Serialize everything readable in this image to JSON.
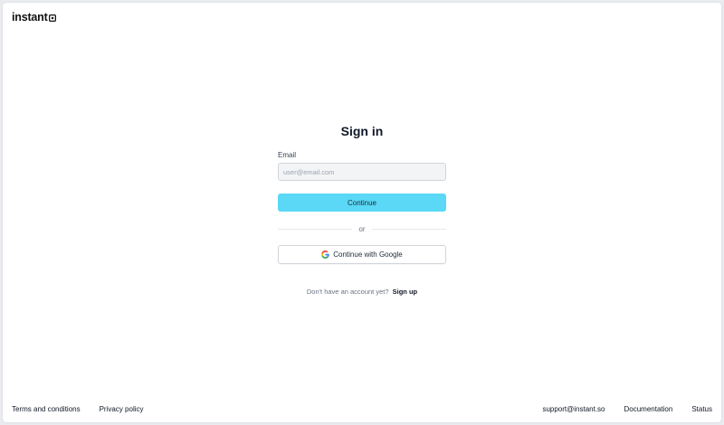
{
  "brand": {
    "name": "instant",
    "logo_icon": "instant-logo-mark-icon"
  },
  "signin": {
    "title": "Sign in",
    "email_label": "Email",
    "email_placeholder": "user@email.com",
    "email_value": "",
    "continue_label": "Continue",
    "divider_text": "or",
    "google_label": "Continue with Google",
    "google_icon": "google-g-icon",
    "no_account_text": "Don't have an account yet?",
    "signup_label": "Sign up"
  },
  "footer": {
    "left": [
      {
        "label": "Terms and conditions"
      },
      {
        "label": "Privacy policy"
      }
    ],
    "right": [
      {
        "label": "support@instant.so"
      },
      {
        "label": "Documentation"
      },
      {
        "label": "Status"
      }
    ]
  },
  "colors": {
    "accent": "#5ad8f5",
    "text": "#111827",
    "muted": "#6b7280",
    "input_bg": "#f3f4f6"
  }
}
